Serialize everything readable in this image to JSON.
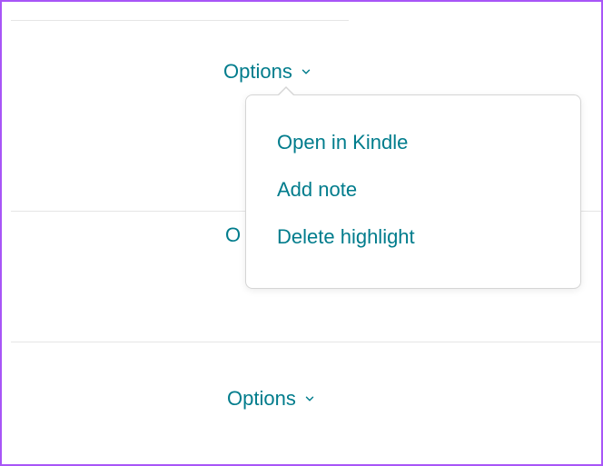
{
  "options_label": "Options",
  "popover": {
    "items": [
      "Open in Kindle",
      "Add note",
      "Delete highlight"
    ]
  },
  "obscured_char": "O",
  "colors": {
    "accent": "#007c8c",
    "border": "#a855f7"
  }
}
